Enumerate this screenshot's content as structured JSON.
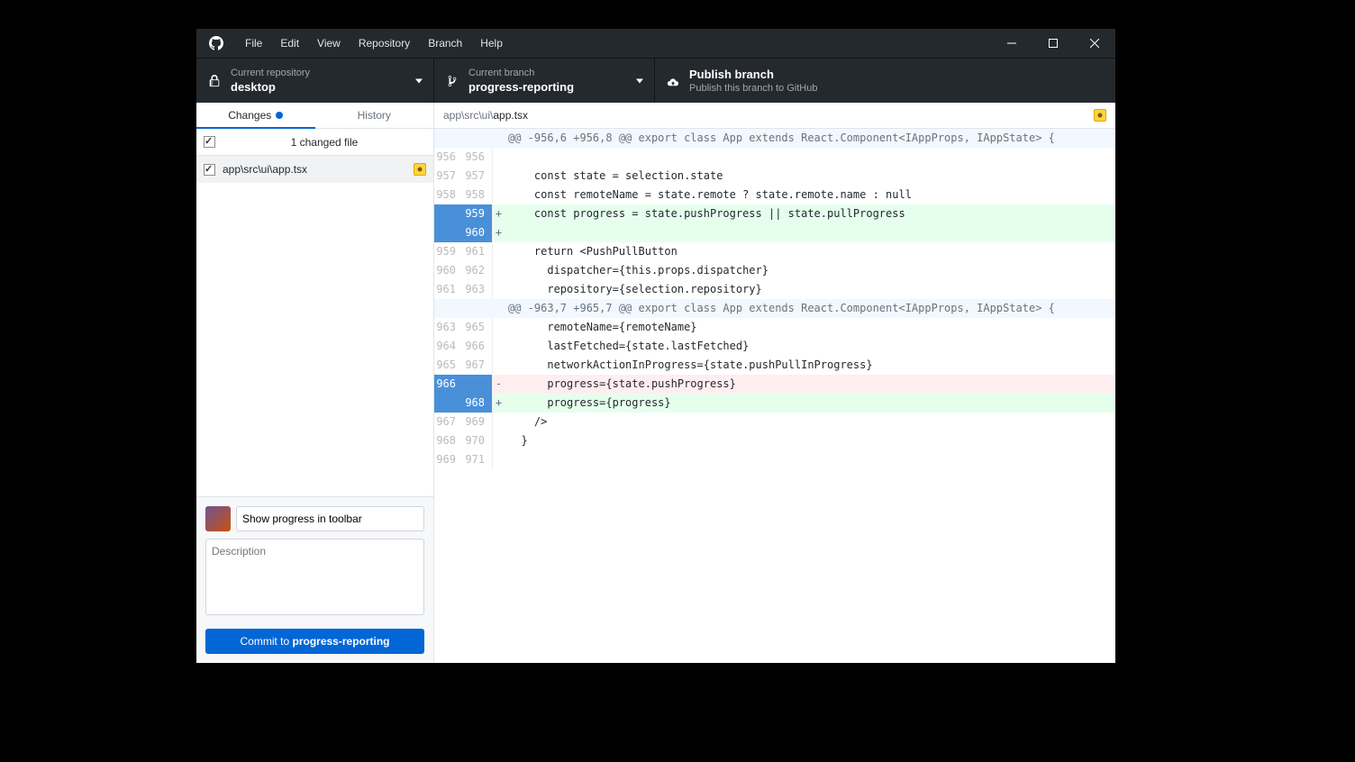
{
  "menu": {
    "items": [
      "File",
      "Edit",
      "View",
      "Repository",
      "Branch",
      "Help"
    ]
  },
  "toolbar": {
    "repo": {
      "label": "Current repository",
      "value": "desktop"
    },
    "branch": {
      "label": "Current branch",
      "value": "progress-reporting"
    },
    "publish": {
      "label": "Publish branch",
      "value": "Publish this branch to GitHub"
    }
  },
  "sidebar": {
    "tabs": {
      "changes": "Changes",
      "history": "History"
    },
    "changes_count_label": "1 changed file",
    "files": [
      {
        "path": "app\\src\\ui\\app.tsx"
      }
    ],
    "commit": {
      "summary": "Show progress in toolbar",
      "description_placeholder": "Description",
      "commit_prefix": "Commit to ",
      "commit_branch": "progress-reporting"
    }
  },
  "diff": {
    "path_prefix": "app\\src\\ui\\",
    "path_file": "app.tsx",
    "lines": [
      {
        "type": "hunk",
        "old": "",
        "new": "",
        "marker": "",
        "text": "@@ -956,6 +956,8 @@ export class App extends React.Component<IAppProps, IAppState> {"
      },
      {
        "type": "ctx",
        "old": "956",
        "new": "956",
        "marker": "",
        "text": ""
      },
      {
        "type": "ctx",
        "old": "957",
        "new": "957",
        "marker": "",
        "text": "    const state = selection.state"
      },
      {
        "type": "ctx",
        "old": "958",
        "new": "958",
        "marker": "",
        "text": "    const remoteName = state.remote ? state.remote.name : null"
      },
      {
        "type": "add",
        "old": "",
        "new": "959",
        "marker": "+",
        "text": "    const progress = state.pushProgress || state.pullProgress"
      },
      {
        "type": "add",
        "old": "",
        "new": "960",
        "marker": "+",
        "text": ""
      },
      {
        "type": "ctx",
        "old": "959",
        "new": "961",
        "marker": "",
        "text": "    return <PushPullButton"
      },
      {
        "type": "ctx",
        "old": "960",
        "new": "962",
        "marker": "",
        "text": "      dispatcher={this.props.dispatcher}"
      },
      {
        "type": "ctx",
        "old": "961",
        "new": "963",
        "marker": "",
        "text": "      repository={selection.repository}"
      },
      {
        "type": "hunk",
        "old": "",
        "new": "",
        "marker": "",
        "text": "@@ -963,7 +965,7 @@ export class App extends React.Component<IAppProps, IAppState> {"
      },
      {
        "type": "ctx",
        "old": "963",
        "new": "965",
        "marker": "",
        "text": "      remoteName={remoteName}"
      },
      {
        "type": "ctx",
        "old": "964",
        "new": "966",
        "marker": "",
        "text": "      lastFetched={state.lastFetched}"
      },
      {
        "type": "ctx",
        "old": "965",
        "new": "967",
        "marker": "",
        "text": "      networkActionInProgress={state.pushPullInProgress}"
      },
      {
        "type": "del",
        "old": "966",
        "new": "",
        "marker": "-",
        "text": "      progress={state.pushProgress}"
      },
      {
        "type": "add",
        "old": "",
        "new": "968",
        "marker": "+",
        "text": "      progress={progress}"
      },
      {
        "type": "ctx",
        "old": "967",
        "new": "969",
        "marker": "",
        "text": "    />"
      },
      {
        "type": "ctx",
        "old": "968",
        "new": "970",
        "marker": "",
        "text": "  }"
      },
      {
        "type": "ctx",
        "old": "969",
        "new": "971",
        "marker": "",
        "text": ""
      }
    ]
  }
}
